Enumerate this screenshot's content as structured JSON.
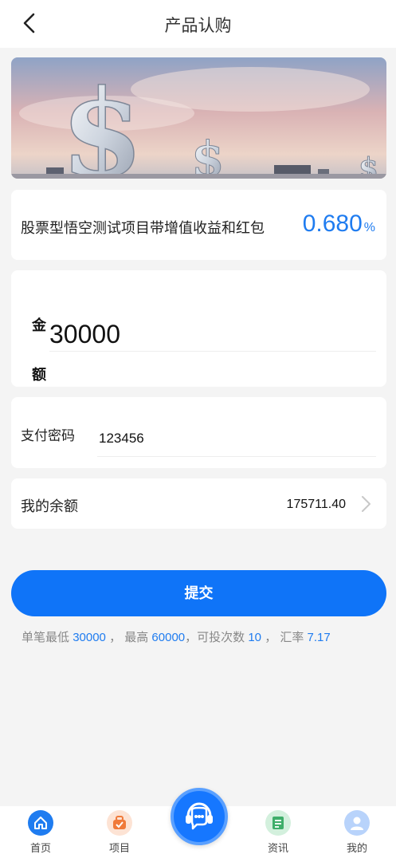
{
  "header": {
    "title": "产品认购"
  },
  "product": {
    "name": "股票型悟空测试项目带增值收益和红包",
    "rate": "0.680",
    "rate_unit": "%"
  },
  "amount": {
    "label": "金额",
    "value": "30000"
  },
  "password": {
    "label": "支付密码",
    "value": "123456"
  },
  "balance": {
    "label": "我的余额",
    "value": "175711.40"
  },
  "submit": {
    "label": "提交"
  },
  "limits": {
    "min_prefix": "单笔最低",
    "min_value": "30000",
    "max_prefix": "， 最高",
    "max_value": "60000",
    "times_prefix": "，可投次数",
    "times_value": "10",
    "rate_prefix": "， 汇率",
    "rate_value": "7.17"
  },
  "tabbar": {
    "items": [
      {
        "label": "首页",
        "icon": "home-icon",
        "color": "#1f7cf0"
      },
      {
        "label": "项目",
        "icon": "project-icon",
        "color": "#f07a3a"
      },
      {
        "label": "资讯",
        "icon": "news-icon",
        "color": "#3fae6a"
      },
      {
        "label": "我的",
        "icon": "user-icon",
        "color": "#5a9cf5"
      }
    ],
    "service_icon": "customer-service-icon"
  }
}
